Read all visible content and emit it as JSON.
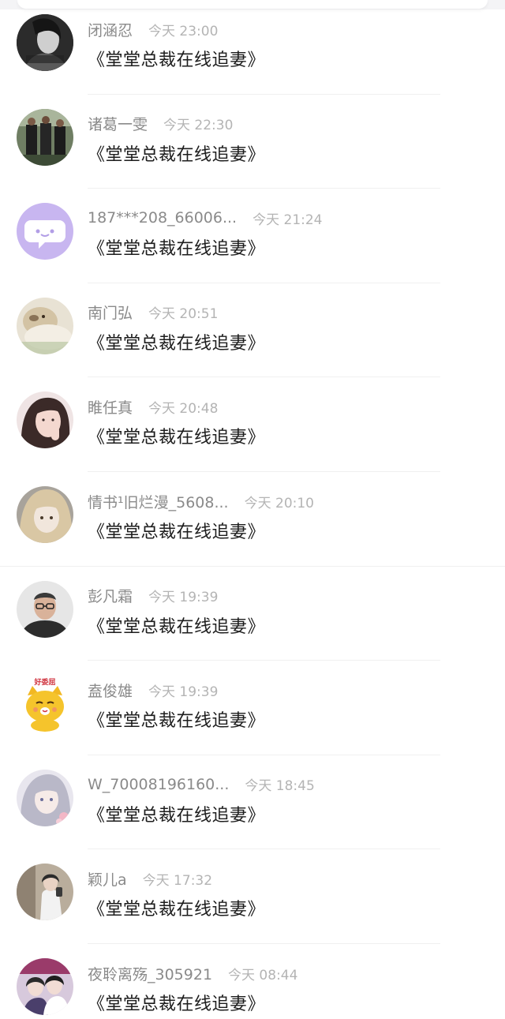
{
  "comments": [
    {
      "name": "闭涵忍",
      "time": "今天 23:00",
      "message": "《堂堂总裁在线追妻》",
      "avatar": "dark-portrait-avatar"
    },
    {
      "name": "诸葛一雯",
      "time": "今天 22:30",
      "message": "《堂堂总裁在线追妻》",
      "avatar": "team-photo-avatar"
    },
    {
      "name": "187***208_66006...",
      "time": "今天 21:24",
      "message": "《堂堂总裁在线追妻》",
      "avatar": "default-chat-bubble-avatar"
    },
    {
      "name": "南门弘",
      "time": "今天 20:51",
      "message": "《堂堂总裁在线追妻》",
      "avatar": "blurry-dog-avatar"
    },
    {
      "name": "睢任真",
      "time": "今天 20:48",
      "message": "《堂堂总裁在线追妻》",
      "avatar": "girl-portrait-avatar"
    },
    {
      "name": "情书¹旧烂漫_5608...",
      "time": "今天 20:10",
      "message": "《堂堂总裁在线追妻》",
      "avatar": "anime-girl-avatar"
    },
    {
      "name": "彭凡霜",
      "time": "今天 19:39",
      "message": "《堂堂总裁在线追妻》",
      "avatar": "man-glasses-avatar"
    },
    {
      "name": "盍俊雄",
      "time": "今天 19:39",
      "message": "《堂堂总裁在线追妻》",
      "avatar": "cartoon-cat-avatar",
      "avatar_text": "好委屈"
    },
    {
      "name": "W_70008196160...",
      "time": "今天 18:45",
      "message": "《堂堂总裁在线追妻》",
      "avatar": "illustrated-girl-avatar"
    },
    {
      "name": "颖儿a",
      "time": "今天 17:32",
      "message": "《堂堂总裁在线追妻》",
      "avatar": "mirror-selfie-avatar"
    },
    {
      "name": "夜聆离殇_305921",
      "time": "今天 08:44",
      "message": "《堂堂总裁在线追妻》",
      "avatar": "couple-photo-avatar"
    }
  ],
  "colors": {
    "name": "#8a8a8a",
    "time": "#b4b4b4",
    "message": "#1d1d1d",
    "divider": "#f0f0f0",
    "default_avatar": "#c8b6f0"
  }
}
